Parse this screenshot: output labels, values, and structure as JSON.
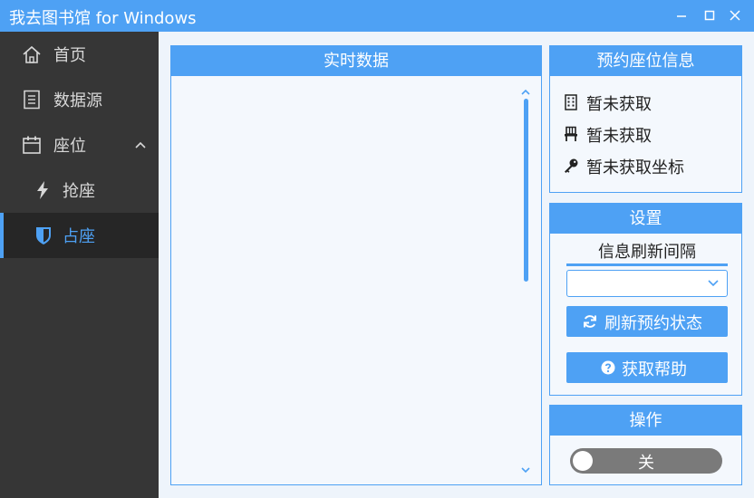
{
  "window": {
    "title": "我去图书馆  for Windows"
  },
  "sidebar": {
    "items": [
      {
        "label": "首页",
        "icon": "home-icon"
      },
      {
        "label": "数据源",
        "icon": "document-icon"
      },
      {
        "label": "座位",
        "icon": "calendar-icon"
      },
      {
        "label": "抢座",
        "icon": "lightning-icon"
      },
      {
        "label": "占座",
        "icon": "shield-icon"
      }
    ],
    "active_index": 4
  },
  "realtime": {
    "title": "实时数据"
  },
  "reservation": {
    "title": "预约座位信息",
    "library": "暂未获取",
    "seat": "暂未获取",
    "coords": "暂未获取坐标"
  },
  "settings": {
    "title": "设置",
    "interval_label": "信息刷新间隔",
    "interval_value": "",
    "refresh_button": "刷新预约状态",
    "help_button": "获取帮助"
  },
  "operation": {
    "title": "操作",
    "toggle_label": "关",
    "toggle_on": false
  },
  "colors": {
    "accent": "#4ea1f4",
    "sidebar_bg": "#363636",
    "sidebar_active_bg": "#262626",
    "panel_bg": "#f4f8fd"
  }
}
